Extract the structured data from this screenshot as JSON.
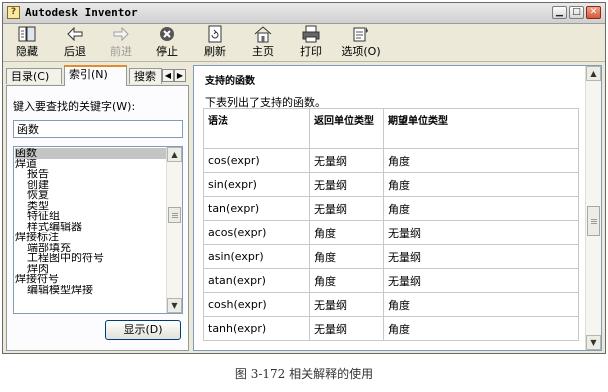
{
  "window": {
    "title": "Autodesk Inventor",
    "controls": [
      "minimize",
      "maximize",
      "close"
    ]
  },
  "toolbar": {
    "items": [
      {
        "label": "隐藏",
        "icon": "hide-icon",
        "enabled": true
      },
      {
        "label": "后退",
        "icon": "back-arrow-icon",
        "enabled": true
      },
      {
        "label": "前进",
        "icon": "forward-arrow-icon",
        "enabled": false
      },
      {
        "label": "停止",
        "icon": "stop-icon",
        "enabled": true
      },
      {
        "label": "刷新",
        "icon": "refresh-icon",
        "enabled": true
      },
      {
        "label": "主页",
        "icon": "home-icon",
        "enabled": true
      },
      {
        "label": "打印",
        "icon": "print-icon",
        "enabled": true
      },
      {
        "label": "选项(O)",
        "icon": "options-icon",
        "enabled": true
      }
    ]
  },
  "nav": {
    "tabs": [
      {
        "label": "目录(C)"
      },
      {
        "label": "索引(N)"
      },
      {
        "label": "搜索"
      }
    ],
    "active_tab": "索引(N)",
    "keyword_label": "键入要查找的关键字(W):",
    "keyword_value": "函数",
    "index_items": [
      "函数",
      "焊道",
      "报告",
      "创建",
      "恢复",
      "类型",
      "特征组",
      "样式编辑器",
      "焊接标注",
      "端部填充",
      "工程图中的符号",
      "焊肉",
      "焊接符号",
      "编辑模型焊接"
    ],
    "display_button": "显示(D)"
  },
  "content": {
    "title": "支持的函数",
    "description": "下表列出了支持的函数。",
    "columns": [
      "语法",
      "返回单位类型",
      "期望单位类型"
    ],
    "rows": [
      [
        "cos(expr)",
        "无量纲",
        "角度"
      ],
      [
        "sin(expr)",
        "无量纲",
        "角度"
      ],
      [
        "tan(expr)",
        "无量纲",
        "角度"
      ],
      [
        "acos(expr)",
        "角度",
        "无量纲"
      ],
      [
        "asin(expr)",
        "角度",
        "无量纲"
      ],
      [
        "atan(expr)",
        "角度",
        "无量纲"
      ],
      [
        "cosh(expr)",
        "无量纲",
        "角度"
      ],
      [
        "tanh(expr)",
        "无量纲",
        "角度"
      ]
    ]
  },
  "caption": "图 3-172  相关解释的使用"
}
